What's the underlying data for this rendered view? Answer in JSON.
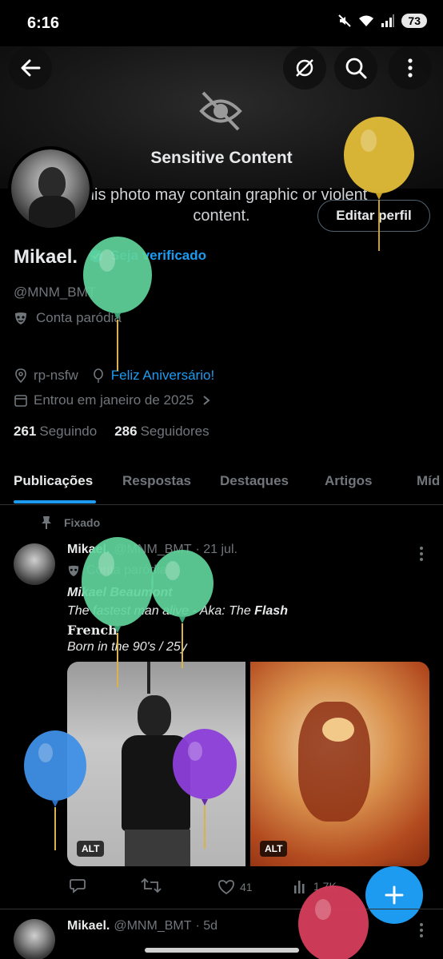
{
  "status_bar": {
    "time": "6:16",
    "battery": "73"
  },
  "banner": {
    "title": "Sensitive Content",
    "subtitle": "This photo may contain graphic or violent content."
  },
  "profile": {
    "edit_button": "Editar perfil",
    "name": "Mikael.",
    "verify_label": "Seja verificado",
    "handle": "@MNM_BMT",
    "parody_label": "Conta paródia",
    "location": "rp-nsfw",
    "birthday": "Feliz Aniversário!",
    "joined": "Entrou em janeiro de 2025",
    "following_count": "261",
    "following_label": "Seguindo",
    "followers_count": "286",
    "followers_label": "Seguidores"
  },
  "tabs": [
    "Publicações",
    "Respostas",
    "Destaques",
    "Artigos",
    "Míd"
  ],
  "pinned_label": "Fixado",
  "post1": {
    "name": "Mikael.",
    "handle": "@MNM_BMT",
    "time": "· 21 jul.",
    "parody_label": "Conta paródia",
    "line1": "Mikael Beaumont",
    "line2_prefix": "The fastest man alive - Aka: The ",
    "line2_bold": "Flash",
    "line3": "French",
    "line4": "Born in the 90's / 25y",
    "alt_label": "ALT",
    "likes": "41",
    "views": "1,7K"
  },
  "post2": {
    "name": "Mikael.",
    "handle": "@MNM_BMT",
    "time": "· 5d"
  },
  "colors": {
    "accent": "#1d9bf0",
    "muted": "#71767b",
    "text": "#e7e9ea",
    "background": "#000000"
  },
  "icons": [
    "back-arrow-icon",
    "hidden-eye-icon",
    "visibility-toggle-icon",
    "search-icon",
    "more-vertical-icon",
    "verified-badge-icon",
    "mask-icon",
    "location-icon",
    "balloon-icon",
    "calendar-icon",
    "chevron-right-icon",
    "pin-icon",
    "reply-icon",
    "retweet-icon",
    "heart-icon",
    "views-icon",
    "plus-icon"
  ]
}
